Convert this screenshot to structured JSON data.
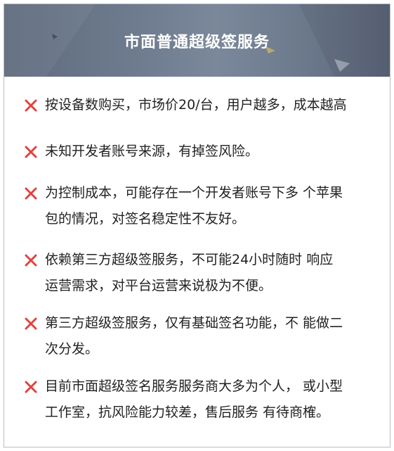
{
  "header": {
    "title": "市面普通超级签服务"
  },
  "items": [
    {
      "icon": "cross-icon",
      "lines": [
        "按设备数购买，市场价20/台，用户越多，成本越高"
      ]
    },
    {
      "icon": "cross-icon",
      "lines": [
        "未知开发者账号来源，有掉签风险。"
      ]
    },
    {
      "icon": "cross-icon",
      "lines": [
        "为控制成本，可能存在一个开发者账号下多 个苹果",
        "包的情况，对签名稳定性不友好。"
      ]
    },
    {
      "icon": "cross-icon",
      "lines": [
        "依赖第三方超级签服务，不可能24小时随时 响应",
        "运营需求，对平台运营来说极为不便。"
      ]
    },
    {
      "icon": "cross-icon",
      "lines": [
        "第三方超级签服务，仅有基础签名功能，不 能做二",
        "次分发。"
      ]
    },
    {
      "icon": "cross-icon",
      "lines": [
        "目前市面超级签名服务服务商大多为个人， 或小型",
        "工作室，抗风险能力较差，售后服务 有待商榷。"
      ]
    }
  ],
  "colors": {
    "cross": "#e0433f",
    "text": "#222222",
    "header_text": "#ffffff"
  }
}
